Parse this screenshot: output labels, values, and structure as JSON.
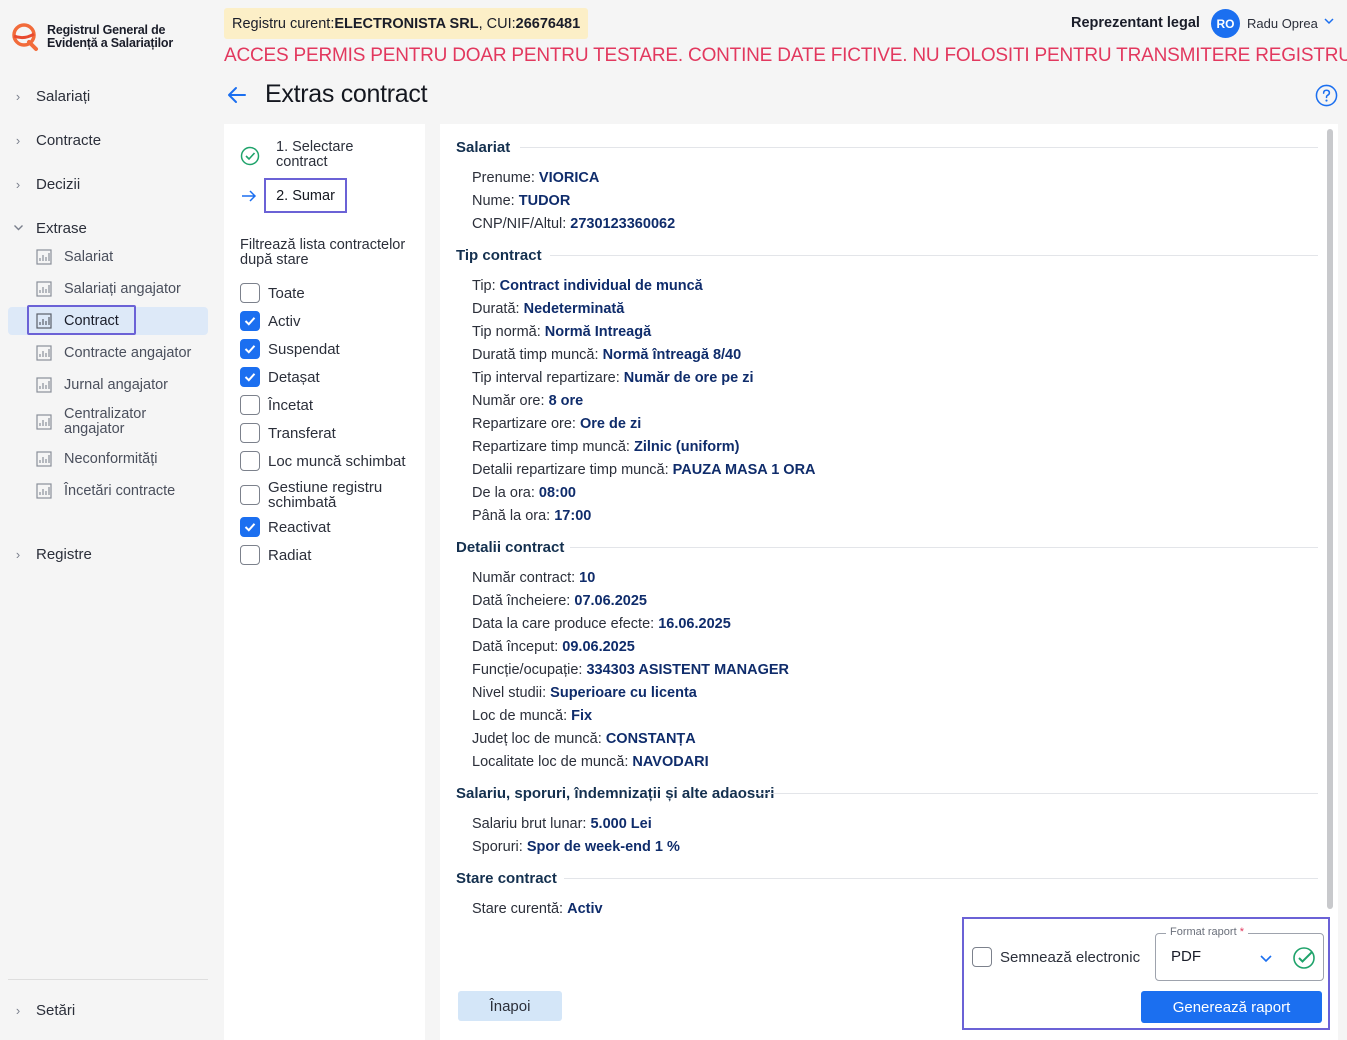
{
  "app": {
    "logo_text_line1": "Registrul General de",
    "logo_text_line2": "Evidență a Salariaților"
  },
  "header": {
    "registry_prefix": "Registru curent: ",
    "registry_name": "ELECTRONISTA SRL",
    "registry_cui_prefix": ", CUI: ",
    "registry_cui": "26676481",
    "warning": "ACCES PERMIS PENTRU DOAR PENTRU TESTARE. CONTINE DATE FICTIVE. NU FOLOSITI PENTRU TRANSMITERE REGISTRU",
    "role": "Reprezentant legal",
    "avatar_initials": "RO",
    "user_name": "Radu Oprea"
  },
  "sidebar": {
    "top_items": [
      "Salariați",
      "Contracte",
      "Decizii",
      "Extrase",
      "Registre",
      "Setări"
    ],
    "extrase_items": [
      "Salariat",
      "Salariați angajator",
      "Contract",
      "Contracte angajator",
      "Jurnal angajator",
      "Centralizator angajator",
      "Neconformități",
      "Încetări contracte"
    ],
    "active_item": "Contract"
  },
  "page": {
    "title": "Extras contract"
  },
  "steps": {
    "step1": "1. Selectare contract",
    "step2": "2. Sumar",
    "filter_title": "Filtrează lista contractelor după stare",
    "filters": [
      {
        "label": "Toate",
        "checked": false
      },
      {
        "label": "Activ",
        "checked": true
      },
      {
        "label": "Suspendat",
        "checked": true
      },
      {
        "label": "Detașat",
        "checked": true
      },
      {
        "label": "Încetat",
        "checked": false
      },
      {
        "label": "Transferat",
        "checked": false
      },
      {
        "label": "Loc muncă schimbat",
        "checked": false
      },
      {
        "label": "Gestiune registru schimbată",
        "checked": false
      },
      {
        "label": "Reactivat",
        "checked": true
      },
      {
        "label": "Radiat",
        "checked": false
      }
    ]
  },
  "summary": {
    "sections": [
      {
        "title": "Salariat",
        "rows": [
          {
            "label": "Prenume: ",
            "value": "VIORICA"
          },
          {
            "label": "Nume: ",
            "value": "TUDOR"
          },
          {
            "label": "CNP/NIF/Altul: ",
            "value": "2730123360062"
          }
        ]
      },
      {
        "title": "Tip contract",
        "rows": [
          {
            "label": "Tip: ",
            "value": "Contract individual de muncă"
          },
          {
            "label": "Durată: ",
            "value": "Nedeterminată"
          },
          {
            "label": "Tip normă: ",
            "value": "Normă Intreagă"
          },
          {
            "label": "Durată timp muncă: ",
            "value": "Normă întreagă 8/40"
          },
          {
            "label": "Tip interval repartizare: ",
            "value": "Număr de ore pe zi"
          },
          {
            "label": "Număr ore: ",
            "value": "8 ore"
          },
          {
            "label": "Repartizare ore: ",
            "value": "Ore de zi"
          },
          {
            "label": "Repartizare timp muncă: ",
            "value": "Zilnic (uniform)"
          },
          {
            "label": "Detalii repartizare timp muncă: ",
            "value": "PAUZA MASA 1 ORA"
          },
          {
            "label": "De la ora: ",
            "value": "08:00"
          },
          {
            "label": "Până la ora: ",
            "value": "17:00"
          }
        ]
      },
      {
        "title": "Detalii contract",
        "rows": [
          {
            "label": "Număr contract: ",
            "value": "10"
          },
          {
            "label": "Dată încheiere: ",
            "value": "07.06.2025"
          },
          {
            "label": "Data la care produce efecte: ",
            "value": "16.06.2025"
          },
          {
            "label": "Dată început: ",
            "value": "09.06.2025"
          },
          {
            "label": "Funcție/ocupație: ",
            "value": "334303 ASISTENT MANAGER"
          },
          {
            "label": "Nivel studii: ",
            "value": "Superioare cu licenta"
          },
          {
            "label": "Loc de muncă: ",
            "value": "Fix"
          },
          {
            "label": "Județ loc de muncă: ",
            "value": "CONSTANȚA"
          },
          {
            "label": "Localitate loc de muncă: ",
            "value": "NAVODARI"
          }
        ]
      },
      {
        "title": "Salariu, sporuri, îndemnizații și alte adaosuri",
        "rows": [
          {
            "label": "Salariu brut lunar: ",
            "value": "5.000 Lei"
          },
          {
            "label": "Sporuri: ",
            "value": "Spor de week-end 1 %"
          }
        ]
      },
      {
        "title": "Stare contract",
        "rows": [
          {
            "label": "Stare curentă: ",
            "value": "Activ"
          }
        ]
      }
    ]
  },
  "actions": {
    "back_label": "Înapoi",
    "sign_label": "Semnează electronic",
    "format_legend": "Format raport",
    "format_required": "*",
    "format_value": "PDF",
    "generate_label": "Generează raport"
  },
  "colors": {
    "primary": "#1b6ff0",
    "highlight_border": "#6b62d6",
    "warning_text": "#e2385e",
    "badge_bg": "#fcefc7",
    "value_text": "#0f2c6b",
    "success": "#1fa36b"
  }
}
